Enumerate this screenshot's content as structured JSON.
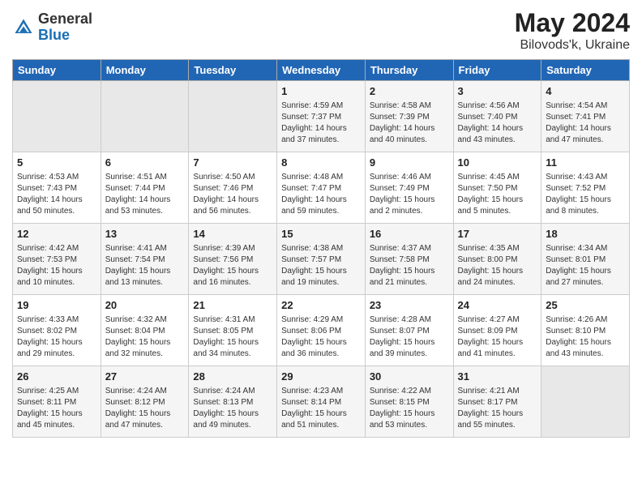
{
  "header": {
    "logo_general": "General",
    "logo_blue": "Blue",
    "month": "May 2024",
    "location": "Bilovods'k, Ukraine"
  },
  "weekdays": [
    "Sunday",
    "Monday",
    "Tuesday",
    "Wednesday",
    "Thursday",
    "Friday",
    "Saturday"
  ],
  "weeks": [
    [
      {
        "day": "",
        "empty": true
      },
      {
        "day": "",
        "empty": true
      },
      {
        "day": "",
        "empty": true
      },
      {
        "day": "1",
        "sunrise": "4:59 AM",
        "sunset": "7:37 PM",
        "daylight": "14 hours and 37 minutes."
      },
      {
        "day": "2",
        "sunrise": "4:58 AM",
        "sunset": "7:39 PM",
        "daylight": "14 hours and 40 minutes."
      },
      {
        "day": "3",
        "sunrise": "4:56 AM",
        "sunset": "7:40 PM",
        "daylight": "14 hours and 43 minutes."
      },
      {
        "day": "4",
        "sunrise": "4:54 AM",
        "sunset": "7:41 PM",
        "daylight": "14 hours and 47 minutes."
      }
    ],
    [
      {
        "day": "5",
        "sunrise": "4:53 AM",
        "sunset": "7:43 PM",
        "daylight": "14 hours and 50 minutes."
      },
      {
        "day": "6",
        "sunrise": "4:51 AM",
        "sunset": "7:44 PM",
        "daylight": "14 hours and 53 minutes."
      },
      {
        "day": "7",
        "sunrise": "4:50 AM",
        "sunset": "7:46 PM",
        "daylight": "14 hours and 56 minutes."
      },
      {
        "day": "8",
        "sunrise": "4:48 AM",
        "sunset": "7:47 PM",
        "daylight": "14 hours and 59 minutes."
      },
      {
        "day": "9",
        "sunrise": "4:46 AM",
        "sunset": "7:49 PM",
        "daylight": "15 hours and 2 minutes."
      },
      {
        "day": "10",
        "sunrise": "4:45 AM",
        "sunset": "7:50 PM",
        "daylight": "15 hours and 5 minutes."
      },
      {
        "day": "11",
        "sunrise": "4:43 AM",
        "sunset": "7:52 PM",
        "daylight": "15 hours and 8 minutes."
      }
    ],
    [
      {
        "day": "12",
        "sunrise": "4:42 AM",
        "sunset": "7:53 PM",
        "daylight": "15 hours and 10 minutes."
      },
      {
        "day": "13",
        "sunrise": "4:41 AM",
        "sunset": "7:54 PM",
        "daylight": "15 hours and 13 minutes."
      },
      {
        "day": "14",
        "sunrise": "4:39 AM",
        "sunset": "7:56 PM",
        "daylight": "15 hours and 16 minutes."
      },
      {
        "day": "15",
        "sunrise": "4:38 AM",
        "sunset": "7:57 PM",
        "daylight": "15 hours and 19 minutes."
      },
      {
        "day": "16",
        "sunrise": "4:37 AM",
        "sunset": "7:58 PM",
        "daylight": "15 hours and 21 minutes."
      },
      {
        "day": "17",
        "sunrise": "4:35 AM",
        "sunset": "8:00 PM",
        "daylight": "15 hours and 24 minutes."
      },
      {
        "day": "18",
        "sunrise": "4:34 AM",
        "sunset": "8:01 PM",
        "daylight": "15 hours and 27 minutes."
      }
    ],
    [
      {
        "day": "19",
        "sunrise": "4:33 AM",
        "sunset": "8:02 PM",
        "daylight": "15 hours and 29 minutes."
      },
      {
        "day": "20",
        "sunrise": "4:32 AM",
        "sunset": "8:04 PM",
        "daylight": "15 hours and 32 minutes."
      },
      {
        "day": "21",
        "sunrise": "4:31 AM",
        "sunset": "8:05 PM",
        "daylight": "15 hours and 34 minutes."
      },
      {
        "day": "22",
        "sunrise": "4:29 AM",
        "sunset": "8:06 PM",
        "daylight": "15 hours and 36 minutes."
      },
      {
        "day": "23",
        "sunrise": "4:28 AM",
        "sunset": "8:07 PM",
        "daylight": "15 hours and 39 minutes."
      },
      {
        "day": "24",
        "sunrise": "4:27 AM",
        "sunset": "8:09 PM",
        "daylight": "15 hours and 41 minutes."
      },
      {
        "day": "25",
        "sunrise": "4:26 AM",
        "sunset": "8:10 PM",
        "daylight": "15 hours and 43 minutes."
      }
    ],
    [
      {
        "day": "26",
        "sunrise": "4:25 AM",
        "sunset": "8:11 PM",
        "daylight": "15 hours and 45 minutes."
      },
      {
        "day": "27",
        "sunrise": "4:24 AM",
        "sunset": "8:12 PM",
        "daylight": "15 hours and 47 minutes."
      },
      {
        "day": "28",
        "sunrise": "4:24 AM",
        "sunset": "8:13 PM",
        "daylight": "15 hours and 49 minutes."
      },
      {
        "day": "29",
        "sunrise": "4:23 AM",
        "sunset": "8:14 PM",
        "daylight": "15 hours and 51 minutes."
      },
      {
        "day": "30",
        "sunrise": "4:22 AM",
        "sunset": "8:15 PM",
        "daylight": "15 hours and 53 minutes."
      },
      {
        "day": "31",
        "sunrise": "4:21 AM",
        "sunset": "8:17 PM",
        "daylight": "15 hours and 55 minutes."
      },
      {
        "day": "",
        "empty": true
      }
    ]
  ]
}
